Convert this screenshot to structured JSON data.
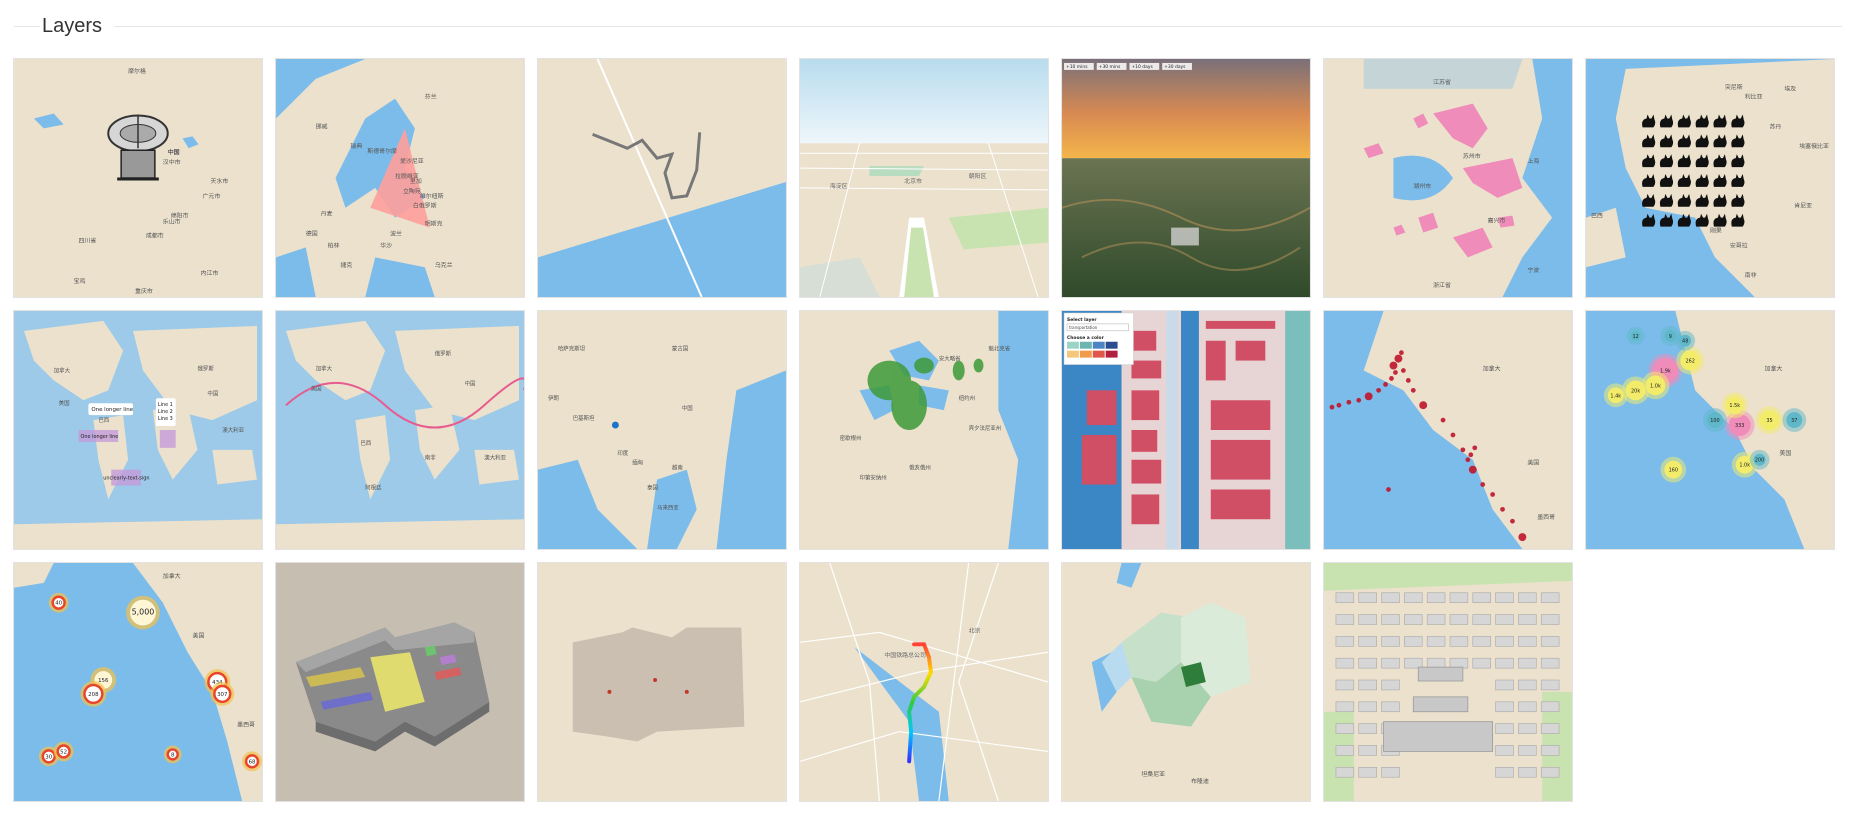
{
  "section": {
    "title": "Layers"
  },
  "colors": {
    "land": "#ebe1cd",
    "water": "#7cbcea",
    "pink": "#ef8cba",
    "cluster_red": "#e8452c"
  },
  "cards": [
    {
      "name": "icon-layer-radar",
      "labels": [
        "摩尔格",
        "中国",
        "四川省",
        "成都市",
        "广元市",
        "重庆市",
        "乐山市",
        "内江市",
        "绵阳市",
        "天水市",
        "汉中市",
        "宝鸡"
      ]
    },
    {
      "name": "polygon-layer-nordic",
      "labels": [
        "挪威",
        "瑞典",
        "芬兰",
        "爱沙尼亚",
        "拉脱维亚",
        "立陶宛",
        "白俄罗斯",
        "波兰",
        "丹麦",
        "德国",
        "捷克",
        "乌克兰",
        "柏林",
        "华沙",
        "斯德哥尔摩",
        "里加",
        "维尔纽斯",
        "明斯克"
      ]
    },
    {
      "name": "line-layer-simple",
      "labels": []
    },
    {
      "name": "3d-city-perspective",
      "labels": [
        "北京市",
        "海淀区",
        "朝阳区"
      ]
    },
    {
      "name": "terrain-sunset",
      "labels": [
        "+10 mins",
        "+30 mins",
        "+10 days",
        "+30 days"
      ]
    },
    {
      "name": "fill-layer-shanghai",
      "labels": [
        "江苏省",
        "上海",
        "浙江省",
        "苏州市",
        "嘉兴市",
        "湖州市",
        "宁波"
      ]
    },
    {
      "name": "cat-icon-africa",
      "labels": [
        "突尼斯",
        "利比亚",
        "埃及",
        "苏丹",
        "埃塞俄比亚",
        "肯尼亚",
        "刚果",
        "安哥拉",
        "南非",
        "巴西"
      ]
    },
    {
      "name": "popup-world",
      "labels": [
        "One longer line",
        "Line 1",
        "Line 2",
        "Line 3",
        "One longer line",
        "unclearly-text-sign",
        "加拿大",
        "美国",
        "巴西",
        "中国",
        "俄罗斯",
        "澳大利亚"
      ]
    },
    {
      "name": "sine-line-world",
      "labels": [
        "加拿大",
        "美国",
        "巴西",
        "俄罗斯",
        "中国",
        "澳大利亚",
        "南非",
        "阿根廷"
      ]
    },
    {
      "name": "point-asia",
      "labels": [
        "哈萨克斯坦",
        "蒙古国",
        "中国",
        "印度",
        "伊朗",
        "巴基斯坦",
        "泰国",
        "越南",
        "缅甸",
        "马来西亚"
      ]
    },
    {
      "name": "tree-heatmap-greatlakes",
      "labels": [
        "安大略省",
        "魁北克省",
        "密歇根州",
        "纽约州",
        "宾夕法尼亚州",
        "俄亥俄州",
        "印第安纳州"
      ]
    },
    {
      "name": "building-color-select",
      "labels": [
        "Select layer",
        "transportation",
        "Choose a color"
      ]
    },
    {
      "name": "earthquake-points",
      "labels": [
        "加拿大",
        "美国",
        "墨西哥"
      ]
    },
    {
      "name": "bubble-clusters-pacific",
      "labels": [
        "1.9k",
        "262",
        "1.0k",
        "20k",
        "1.4k",
        "333",
        "1.5k",
        "35",
        "37",
        "48",
        "12",
        "9",
        "160",
        "1.0k",
        "100",
        "200",
        "加拿大",
        "美国"
      ]
    },
    {
      "name": "cluster-markers-pacific",
      "labels": [
        "5,000",
        "40",
        "156",
        "208",
        "434",
        "307",
        "30",
        "52",
        "8",
        "68",
        "美国",
        "加拿大",
        "墨西哥"
      ]
    },
    {
      "name": "indoor-3d-floorplan",
      "labels": []
    },
    {
      "name": "indoor-points",
      "labels": []
    },
    {
      "name": "gradient-route",
      "labels": [
        "中国铁路总公司",
        "北京"
      ]
    },
    {
      "name": "choropleth-region",
      "labels": [
        "布隆迪",
        "坦桑尼亚"
      ]
    },
    {
      "name": "3d-buildings-forbidden-city",
      "labels": []
    }
  ]
}
